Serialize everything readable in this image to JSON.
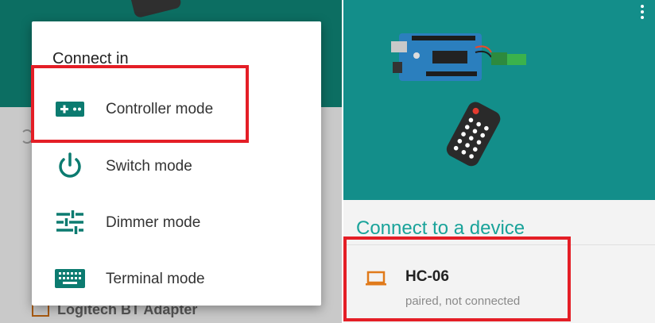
{
  "left_screen": {
    "dialog": {
      "title": "Connect in",
      "options": [
        {
          "label": "Controller mode",
          "icon": "gamepad-icon"
        },
        {
          "label": "Switch mode",
          "icon": "power-icon"
        },
        {
          "label": "Dimmer mode",
          "icon": "sliders-icon"
        },
        {
          "label": "Terminal mode",
          "icon": "keyboard-icon"
        }
      ]
    },
    "background_item": "Logitech BT Adapter",
    "highlight_color": "#e41e26",
    "accent_color": "#0c7b70"
  },
  "right_screen": {
    "section_title": "Connect to a device",
    "device": {
      "name": "HC-06",
      "status": "paired, not connected",
      "icon": "laptop-icon"
    },
    "hero_color": "#138e8a",
    "highlight_color": "#e41e26"
  }
}
